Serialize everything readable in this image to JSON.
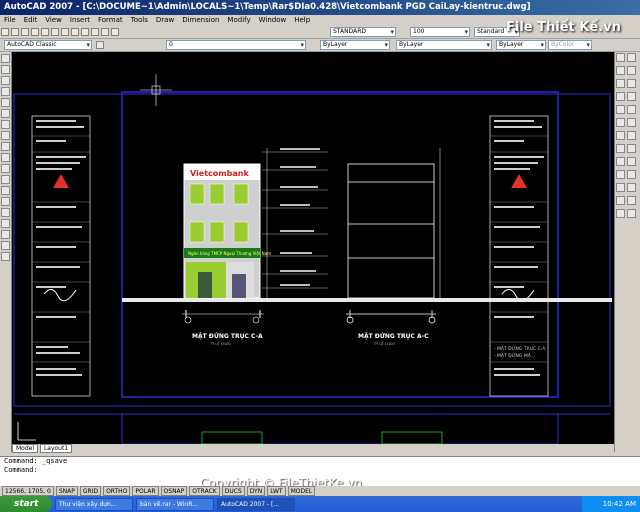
{
  "window": {
    "title": "AutoCAD 2007 - [C:\\DOCUME~1\\Admin\\LOCALS~1\\Temp\\Rar$DIa0.428\\Vietcombank PGD CaiLay-kientruc.dwg]"
  },
  "menu": [
    "File",
    "Edit",
    "View",
    "Insert",
    "Format",
    "Tools",
    "Draw",
    "Dimension",
    "Modify",
    "Window",
    "Help"
  ],
  "toolbar": {
    "workspace": "AutoCAD Classic",
    "layer": "0",
    "text_style": "STANDARD",
    "dim_scale": "100",
    "table_style": "Standard",
    "color": "ByLayer",
    "linetype": "ByLayer",
    "lineweight": "ByLayer",
    "plotstyle": "ByColor"
  },
  "drawing": {
    "sign_text": "Vietcombank",
    "left_caption": "MẶT ĐỨNG TRỤC C-A",
    "right_caption": "MẶT ĐỨNG TRỤC A-C",
    "scale": "TỶ LỆ 1/100",
    "bottom_strip": "Ngân hàng TMCP Ngoại Thương Việt Nam",
    "title_block_notes": [
      "- MẶT ĐỨNG TRỤC C-A.",
      "- MẶT ĐỨNG MẶ..."
    ],
    "annotations": [
      "MÁI TÔN",
      "SÀN MÁI",
      "SÀN LẦU 2",
      "SÀN LẦU 1",
      "SÀN TRỆT",
      "MẶT ĐẤT TỰ NHIÊN"
    ]
  },
  "tabs": {
    "model": "Model",
    "layout": "Layout1"
  },
  "command": {
    "line1": "Command: _qsave",
    "line2": "Command:"
  },
  "status": {
    "coords": "12566, 1705, 0",
    "items": [
      "SNAP",
      "GRID",
      "ORTHO",
      "POLAR",
      "OSNAP",
      "OTRACK",
      "DUCS",
      "DYN",
      "LWT",
      "MODEL"
    ]
  },
  "taskbar": {
    "start": "start",
    "tasks": [
      "Thư viện xây dựn...",
      "bản vẽ.rar - WinR...",
      "AutoCAD 2007 - [..."
    ],
    "clock": "10:42 AM"
  },
  "logo": {
    "text": "File Thiết Kế.vn"
  },
  "watermark": {
    "text": "Copyright © FileThietKe.vn"
  }
}
